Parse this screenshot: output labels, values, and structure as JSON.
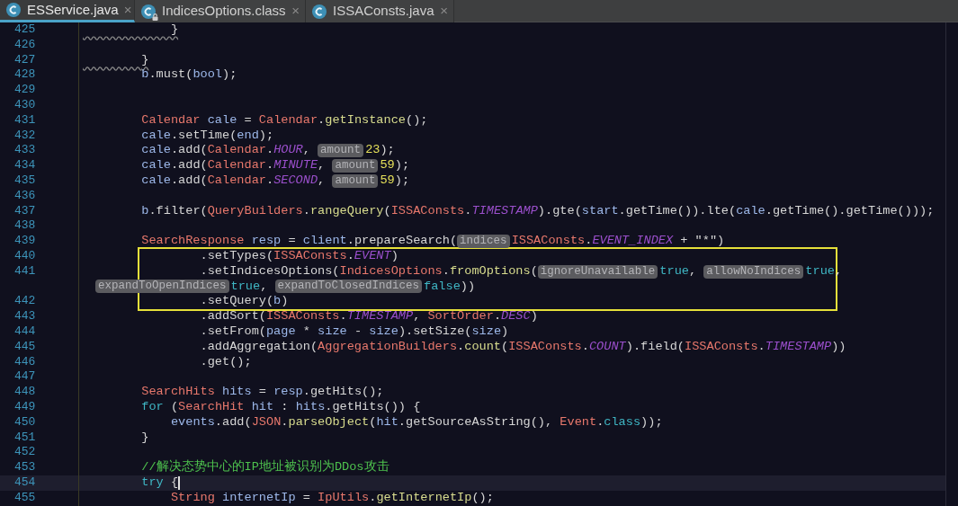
{
  "tabs": [
    {
      "label": "ESService.java",
      "selected": true,
      "close": "×"
    },
    {
      "label": "IndicesOptions.class",
      "selected": false,
      "locked": true,
      "close": "×"
    },
    {
      "label": "ISSAConsts.java",
      "selected": false,
      "close": "×"
    }
  ],
  "editor": {
    "lines": [
      {
        "number": "425",
        "warning": true,
        "tokens": [
          {
            "kind": "txt",
            "text": "            }"
          }
        ]
      },
      {
        "number": "426"
      },
      {
        "number": "427",
        "warning": true,
        "tokens": [
          {
            "kind": "txt",
            "text": "        }"
          }
        ]
      },
      {
        "number": "428",
        "tokens": [
          {
            "kind": "var",
            "text": "        b"
          },
          {
            "kind": "txt",
            "text": ".must("
          },
          {
            "kind": "var",
            "text": "bool"
          },
          {
            "kind": "txt",
            "text": ");"
          }
        ]
      },
      {
        "number": "429"
      },
      {
        "number": "430"
      },
      {
        "number": "431",
        "tokens": [
          {
            "kind": "cls",
            "text": "        Calendar "
          },
          {
            "kind": "var",
            "text": "cale"
          },
          {
            "kind": "txt",
            "text": " = "
          },
          {
            "kind": "cls",
            "text": "Calendar"
          },
          {
            "kind": "txt",
            "text": "."
          },
          {
            "kind": "fn",
            "text": "getInstance"
          },
          {
            "kind": "txt",
            "text": "();"
          }
        ]
      },
      {
        "number": "432",
        "tokens": [
          {
            "kind": "var",
            "text": "        cale"
          },
          {
            "kind": "txt",
            "text": ".setTime("
          },
          {
            "kind": "var",
            "text": "end"
          },
          {
            "kind": "txt",
            "text": ");"
          }
        ]
      },
      {
        "number": "433",
        "tokens": [
          {
            "kind": "var",
            "text": "        cale"
          },
          {
            "kind": "txt",
            "text": ".add("
          },
          {
            "kind": "cls",
            "text": "Calendar"
          },
          {
            "kind": "txt",
            "text": "."
          },
          {
            "kind": "const",
            "text": "HOUR"
          },
          {
            "kind": "txt",
            "text": ", "
          },
          {
            "kind": "hint",
            "text": "amount"
          },
          {
            "kind": "num",
            "text": "23"
          },
          {
            "kind": "txt",
            "text": ");"
          }
        ]
      },
      {
        "number": "434",
        "tokens": [
          {
            "kind": "var",
            "text": "        cale"
          },
          {
            "kind": "txt",
            "text": ".add("
          },
          {
            "kind": "cls",
            "text": "Calendar"
          },
          {
            "kind": "txt",
            "text": "."
          },
          {
            "kind": "const",
            "text": "MINUTE"
          },
          {
            "kind": "txt",
            "text": ", "
          },
          {
            "kind": "hint",
            "text": "amount"
          },
          {
            "kind": "num",
            "text": "59"
          },
          {
            "kind": "txt",
            "text": ");"
          }
        ]
      },
      {
        "number": "435",
        "tokens": [
          {
            "kind": "var",
            "text": "        cale"
          },
          {
            "kind": "txt",
            "text": ".add("
          },
          {
            "kind": "cls",
            "text": "Calendar"
          },
          {
            "kind": "txt",
            "text": "."
          },
          {
            "kind": "const",
            "text": "SECOND"
          },
          {
            "kind": "txt",
            "text": ", "
          },
          {
            "kind": "hint",
            "text": "amount"
          },
          {
            "kind": "num",
            "text": "59"
          },
          {
            "kind": "txt",
            "text": ");"
          }
        ]
      },
      {
        "number": "436"
      },
      {
        "number": "437",
        "tokens": [
          {
            "kind": "var",
            "text": "        b"
          },
          {
            "kind": "txt",
            "text": ".filter("
          },
          {
            "kind": "cls",
            "text": "QueryBuilders"
          },
          {
            "kind": "txt",
            "text": "."
          },
          {
            "kind": "fn",
            "text": "rangeQuery"
          },
          {
            "kind": "txt",
            "text": "("
          },
          {
            "kind": "cls",
            "text": "ISSAConsts"
          },
          {
            "kind": "txt",
            "text": "."
          },
          {
            "kind": "const",
            "text": "TIMESTAMP"
          },
          {
            "kind": "txt",
            "text": ").gte("
          },
          {
            "kind": "var",
            "text": "start"
          },
          {
            "kind": "txt",
            "text": ".getTime()).lte("
          },
          {
            "kind": "var",
            "text": "cale"
          },
          {
            "kind": "txt",
            "text": ".getTime().getTime()));"
          }
        ]
      },
      {
        "number": "438"
      },
      {
        "number": "439",
        "tokens": [
          {
            "kind": "cls",
            "text": "        SearchResponse "
          },
          {
            "kind": "var",
            "text": "resp"
          },
          {
            "kind": "txt",
            "text": " = "
          },
          {
            "kind": "var",
            "text": "client"
          },
          {
            "kind": "txt",
            "text": ".prepareSearch("
          },
          {
            "kind": "hint",
            "text": "indices"
          },
          {
            "kind": "cls",
            "text": "ISSAConsts"
          },
          {
            "kind": "txt",
            "text": "."
          },
          {
            "kind": "const",
            "text": "EVENT_INDEX"
          },
          {
            "kind": "txt",
            "text": " + \"*\")"
          }
        ]
      },
      {
        "number": "440",
        "boxed": true,
        "tokens": [
          {
            "kind": "txt",
            "text": "                .setTypes("
          },
          {
            "kind": "cls",
            "text": "ISSAConsts"
          },
          {
            "kind": "txt",
            "text": "."
          },
          {
            "kind": "const",
            "text": "EVENT"
          },
          {
            "kind": "txt",
            "text": ")"
          }
        ]
      },
      {
        "number": "441",
        "boxed": true,
        "tokens": [
          {
            "kind": "txt",
            "text": "                .setIndicesOptions("
          },
          {
            "kind": "cls",
            "text": "IndicesOptions"
          },
          {
            "kind": "txt",
            "text": "."
          },
          {
            "kind": "fn",
            "text": "fromOptions"
          },
          {
            "kind": "txt",
            "text": "("
          },
          {
            "kind": "hint",
            "text": "ignoreUnavailable"
          },
          {
            "kind": "kw",
            "text": "true"
          },
          {
            "kind": "txt",
            "text": ", "
          },
          {
            "kind": "hint",
            "text": "allowNoIndices"
          },
          {
            "kind": "kw",
            "text": "true"
          },
          {
            "kind": "txt",
            "text": ","
          }
        ]
      },
      {
        "wrapped": true,
        "boxed": true,
        "tokens": [
          {
            "kind": "hint",
            "text": "expandToOpenIndices"
          },
          {
            "kind": "kw",
            "text": "true"
          },
          {
            "kind": "txt",
            "text": ", "
          },
          {
            "kind": "hint",
            "text": "expandToClosedIndices"
          },
          {
            "kind": "kw",
            "text": "false"
          },
          {
            "kind": "txt",
            "text": "))"
          }
        ]
      },
      {
        "number": "442",
        "boxed": true,
        "tokens": [
          {
            "kind": "txt",
            "text": "                .setQuery("
          },
          {
            "kind": "var",
            "text": "b"
          },
          {
            "kind": "txt",
            "text": ")"
          }
        ]
      },
      {
        "number": "443",
        "tokens": [
          {
            "kind": "txt",
            "text": "                .addSort("
          },
          {
            "kind": "cls",
            "text": "ISSAConsts"
          },
          {
            "kind": "txt",
            "text": "."
          },
          {
            "kind": "const",
            "text": "TIMESTAMP"
          },
          {
            "kind": "txt",
            "text": ", "
          },
          {
            "kind": "cls",
            "text": "SortOrder"
          },
          {
            "kind": "txt",
            "text": "."
          },
          {
            "kind": "const",
            "text": "DESC"
          },
          {
            "kind": "txt",
            "text": ")"
          }
        ]
      },
      {
        "number": "444",
        "tokens": [
          {
            "kind": "txt",
            "text": "                .setFrom("
          },
          {
            "kind": "var",
            "text": "page"
          },
          {
            "kind": "txt",
            "text": " * "
          },
          {
            "kind": "var",
            "text": "size"
          },
          {
            "kind": "txt",
            "text": " - "
          },
          {
            "kind": "var",
            "text": "size"
          },
          {
            "kind": "txt",
            "text": ").setSize("
          },
          {
            "kind": "var",
            "text": "size"
          },
          {
            "kind": "txt",
            "text": ")"
          }
        ]
      },
      {
        "number": "445",
        "tokens": [
          {
            "kind": "txt",
            "text": "                .addAggregation("
          },
          {
            "kind": "cls",
            "text": "AggregationBuilders"
          },
          {
            "kind": "txt",
            "text": "."
          },
          {
            "kind": "fn",
            "text": "count"
          },
          {
            "kind": "txt",
            "text": "("
          },
          {
            "kind": "cls",
            "text": "ISSAConsts"
          },
          {
            "kind": "txt",
            "text": "."
          },
          {
            "kind": "const",
            "text": "COUNT"
          },
          {
            "kind": "txt",
            "text": ").field("
          },
          {
            "kind": "cls",
            "text": "ISSAConsts"
          },
          {
            "kind": "txt",
            "text": "."
          },
          {
            "kind": "const",
            "text": "TIMESTAMP"
          },
          {
            "kind": "txt",
            "text": "))"
          }
        ]
      },
      {
        "number": "446",
        "tokens": [
          {
            "kind": "txt",
            "text": "                .get();"
          }
        ]
      },
      {
        "number": "447"
      },
      {
        "number": "448",
        "tokens": [
          {
            "kind": "cls",
            "text": "        SearchHits "
          },
          {
            "kind": "var",
            "text": "hits"
          },
          {
            "kind": "txt",
            "text": " = "
          },
          {
            "kind": "var",
            "text": "resp"
          },
          {
            "kind": "txt",
            "text": ".getHits();"
          }
        ]
      },
      {
        "number": "449",
        "tokens": [
          {
            "kind": "kw",
            "text": "        for"
          },
          {
            "kind": "txt",
            "text": " ("
          },
          {
            "kind": "cls",
            "text": "SearchHit "
          },
          {
            "kind": "var",
            "text": "hit"
          },
          {
            "kind": "txt",
            "text": " : "
          },
          {
            "kind": "var",
            "text": "hits"
          },
          {
            "kind": "txt",
            "text": ".getHits()) {"
          }
        ]
      },
      {
        "number": "450",
        "tokens": [
          {
            "kind": "var",
            "text": "            events"
          },
          {
            "kind": "txt",
            "text": ".add("
          },
          {
            "kind": "cls",
            "text": "JSON"
          },
          {
            "kind": "txt",
            "text": "."
          },
          {
            "kind": "fn",
            "text": "parseObject"
          },
          {
            "kind": "txt",
            "text": "("
          },
          {
            "kind": "var",
            "text": "hit"
          },
          {
            "kind": "txt",
            "text": ".getSourceAsString(), "
          },
          {
            "kind": "cls",
            "text": "Event"
          },
          {
            "kind": "txt",
            "text": "."
          },
          {
            "kind": "kw",
            "text": "class"
          },
          {
            "kind": "txt",
            "text": "));"
          }
        ]
      },
      {
        "number": "451",
        "tokens": [
          {
            "kind": "txt",
            "text": "        }"
          }
        ]
      },
      {
        "number": "452"
      },
      {
        "number": "453",
        "tokens": [
          {
            "kind": "cmt",
            "text": "        //解决态势中心的IP地址被识别为DDos攻击"
          }
        ]
      },
      {
        "number": "454",
        "current": true,
        "tokens": [
          {
            "kind": "kw",
            "text": "        try"
          },
          {
            "kind": "txt",
            "text": " {"
          }
        ]
      },
      {
        "number": "455",
        "tokens": [
          {
            "kind": "cls",
            "text": "            String "
          },
          {
            "kind": "var",
            "text": "internetIp"
          },
          {
            "kind": "txt",
            "text": " = "
          },
          {
            "kind": "cls",
            "text": "IpUtils"
          },
          {
            "kind": "txt",
            "text": "."
          },
          {
            "kind": "fn",
            "text": "getInternetIp"
          },
          {
            "kind": "txt",
            "text": "();"
          }
        ]
      }
    ]
  }
}
